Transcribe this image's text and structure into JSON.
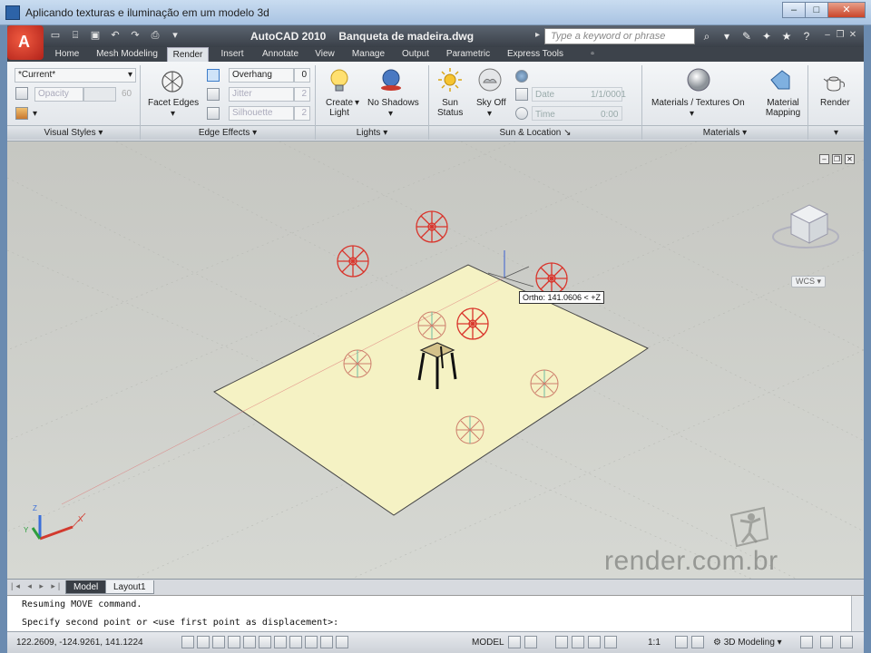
{
  "window": {
    "title": "Aplicando texturas e iluminação em um modelo 3d"
  },
  "app": {
    "name": "AutoCAD 2010",
    "document": "Banqueta de madeira.dwg",
    "search_placeholder": "Type a keyword or phrase"
  },
  "tabs": [
    "Home",
    "Mesh Modeling",
    "Render",
    "Insert",
    "Annotate",
    "View",
    "Manage",
    "Output",
    "Parametric",
    "Express Tools"
  ],
  "active_tab": "Render",
  "ribbon": {
    "visual_styles": {
      "title": "Visual Styles",
      "current": "*Current*",
      "opacity_label": "Opacity",
      "opacity_value": "60"
    },
    "edge_effects": {
      "title": "Edge Effects",
      "facet_edges": "Facet Edges",
      "overhang": "Overhang",
      "overhang_value": "0",
      "jitter": "Jitter",
      "jitter_value": "2",
      "silhouette": "Silhouette",
      "silhouette_value": "2"
    },
    "lights": {
      "title": "Lights",
      "create_light": "Create Light",
      "no_shadows": "No Shadows"
    },
    "sun_location": {
      "title": "Sun & Location",
      "sun_status": "Sun Status",
      "sky_off": "Sky Off",
      "date_label": "Date",
      "date_value": "1/1/0001",
      "time_label": "Time",
      "time_value": "0:00"
    },
    "materials": {
      "title": "Materials",
      "textures_on": "Materials / Textures On",
      "material_mapping": "Material Mapping"
    },
    "render": {
      "label": "Render"
    }
  },
  "viewport": {
    "ortho_tooltip": "Ortho: 141.0606 < +Z",
    "wcs_label": "WCS",
    "watermark": "render.com.br",
    "ucs": {
      "x": "X",
      "y": "Y",
      "z": "Z"
    }
  },
  "layout_tabs": [
    "Model",
    "Layout1"
  ],
  "command": {
    "line1": "Resuming MOVE command.",
    "line2": "Specify second point or <use first point as displacement>:"
  },
  "status": {
    "coords": "122.2609, -124.9261, 141.1224",
    "model": "MODEL",
    "scale": "1:1",
    "workspace": "3D Modeling"
  },
  "colors": {
    "ground": "#f5f2c4",
    "light_red": "#d9342b",
    "light_ghost": "#c0584f",
    "viewport_bg": "#c8cac4"
  }
}
